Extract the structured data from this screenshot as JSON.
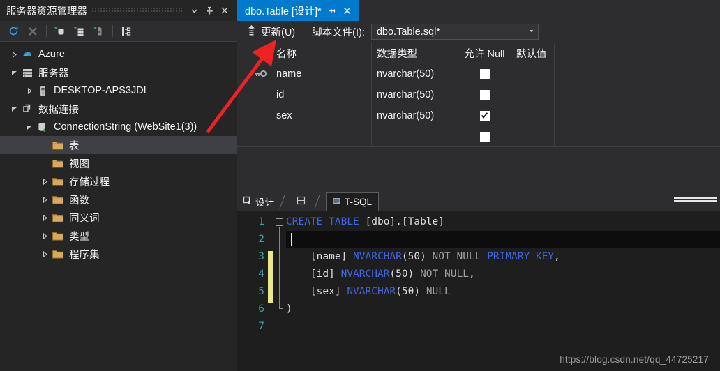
{
  "explorer": {
    "title": "服务器资源管理器",
    "titlebar_icons": [
      "chevron-down-icon",
      "pin-icon",
      "close-icon"
    ],
    "toolbar_icons": [
      "refresh-icon",
      "stop-icon",
      "connect-to-database-icon",
      "connect-to-server-icon",
      "add-server-icon",
      "object-relationships-icon"
    ],
    "tree": [
      {
        "label": "Azure",
        "icon": "azure-cloud-icon",
        "indent": 0,
        "twisty": "collapsed",
        "selected": false
      },
      {
        "label": "服务器",
        "icon": "servers-icon",
        "indent": 0,
        "twisty": "expanded",
        "selected": false
      },
      {
        "label": "DESKTOP-APS3JDI",
        "icon": "server-machine-icon",
        "indent": 1,
        "twisty": "collapsed",
        "selected": false
      },
      {
        "label": "数据连接",
        "icon": "data-connections-icon",
        "indent": 0,
        "twisty": "expanded",
        "selected": false
      },
      {
        "label": "ConnectionString (WebSite1(3))",
        "icon": "database-connection-icon",
        "indent": 1,
        "twisty": "expanded",
        "selected": false
      },
      {
        "label": "表",
        "icon": "folder-icon",
        "indent": 2,
        "twisty": "none",
        "selected": true
      },
      {
        "label": "视图",
        "icon": "folder-icon",
        "indent": 2,
        "twisty": "none",
        "selected": false
      },
      {
        "label": "存储过程",
        "icon": "folder-icon",
        "indent": 2,
        "twisty": "collapsed",
        "selected": false
      },
      {
        "label": "函数",
        "icon": "folder-icon",
        "indent": 2,
        "twisty": "collapsed",
        "selected": false
      },
      {
        "label": "同义词",
        "icon": "folder-icon",
        "indent": 2,
        "twisty": "collapsed",
        "selected": false
      },
      {
        "label": "类型",
        "icon": "folder-icon",
        "indent": 2,
        "twisty": "collapsed",
        "selected": false
      },
      {
        "label": "程序集",
        "icon": "folder-icon",
        "indent": 2,
        "twisty": "collapsed",
        "selected": false
      }
    ]
  },
  "editor": {
    "tab": {
      "label": "dbo.Table [设计]*",
      "pin_icon": "pin-icon",
      "close_icon": "close-icon"
    },
    "toolbar": {
      "update_label": "更新(U)",
      "update_icon": "update-arrow-icon",
      "script_file_label": "脚本文件(I):",
      "script_file_value": "dbo.Table.sql*",
      "dropdown_icon": "chevron-down-icon"
    },
    "grid": {
      "columns": [
        "名称",
        "数据类型",
        "允许 Null",
        "默认值"
      ],
      "rows": [
        {
          "key": true,
          "name": "name",
          "type": "nvarchar(50)",
          "allow_null": false,
          "default": ""
        },
        {
          "key": false,
          "name": "id",
          "type": "nvarchar(50)",
          "allow_null": false,
          "default": ""
        },
        {
          "key": false,
          "name": "sex",
          "type": "nvarchar(50)",
          "allow_null": true,
          "default": ""
        },
        {
          "key": false,
          "name": "",
          "type": "",
          "allow_null": false,
          "default": ""
        }
      ]
    },
    "code_tabs": [
      {
        "label": "设计",
        "icon": "design-view-icon",
        "active": false
      },
      {
        "label": "",
        "icon": "split-view-icon",
        "active": false
      },
      {
        "label": "T-SQL",
        "icon": "tsql-view-icon",
        "active": true
      }
    ],
    "code": {
      "line_numbers": [
        "1",
        "2",
        "3",
        "4",
        "5",
        "6",
        "7"
      ],
      "lines": [
        "CREATE TABLE [dbo].[Table]",
        "(",
        "    [name] NVARCHAR(50) NOT NULL PRIMARY KEY,",
        "    [id] NVARCHAR(50) NOT NULL,",
        "    [sex] NVARCHAR(50) NULL",
        ")",
        ""
      ],
      "changed_lines": [
        "3",
        "4",
        "5"
      ]
    }
  },
  "watermark": "https://blog.csdn.net/qq_44725217",
  "annotation": {
    "type": "red-arrow",
    "color": "#ee2222",
    "points_to": "更新(U)"
  },
  "colors": {
    "accent": "#007acc",
    "panel_bg": "#252526",
    "toolbar_bg": "#2d2d30",
    "editor_bg": "#1e1e1e",
    "keyword": "#3f66e0",
    "line_number": "#3f9fa8",
    "change_bar": "#e8e88c",
    "selection": "#3f3f46"
  }
}
